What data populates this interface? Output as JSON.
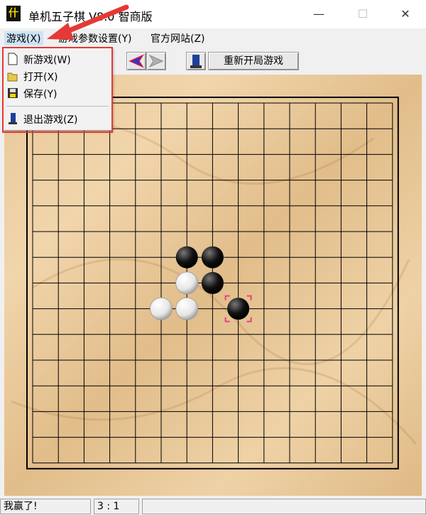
{
  "window": {
    "icon_glyph": "什",
    "title": "单机五子棋 V8.0 智商版",
    "minimize_glyph": "—",
    "maximize_glyph": "☐",
    "close_glyph": "✕"
  },
  "menubar": {
    "items": [
      {
        "label": "游戏(X)"
      },
      {
        "label": "游戏参数设置(Y)"
      },
      {
        "label": "官方网站(Z)"
      }
    ]
  },
  "dropdown": {
    "items": [
      {
        "label": "新游戏(W)",
        "icon": "new-document-icon"
      },
      {
        "label": "打开(X)",
        "icon": "open-folder-icon"
      },
      {
        "label": "保存(Y)",
        "icon": "save-disk-icon"
      },
      {
        "label": "退出游戏(Z)",
        "icon": "exit-icon"
      }
    ]
  },
  "toolbar": {
    "restart_label": "重新开局游戏",
    "icons": [
      "undo-arrow-icon",
      "redo-arrow-icon",
      "player-icon"
    ]
  },
  "board": {
    "size": 15,
    "black_stones": [
      [
        6,
        6
      ],
      [
        7,
        6
      ],
      [
        7,
        7
      ],
      [
        8,
        8
      ]
    ],
    "white_stones": [
      [
        6,
        7
      ],
      [
        5,
        8
      ],
      [
        6,
        8
      ]
    ],
    "last_move": [
      8,
      8
    ],
    "last_move_color": "#e0457b"
  },
  "status": {
    "message": "我赢了!",
    "score": "3 : 1"
  },
  "colors": {
    "annotation_red": "#e53935"
  }
}
